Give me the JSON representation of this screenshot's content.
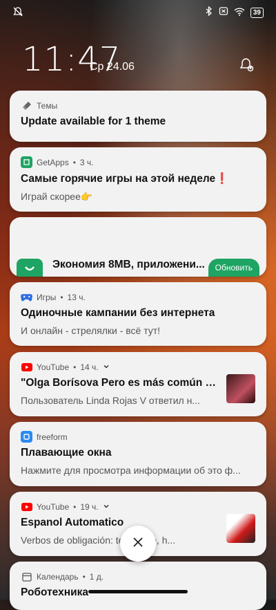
{
  "status_bar": {
    "battery": "39"
  },
  "lock": {
    "time": "11:47",
    "date": "Ср 24.06"
  },
  "notifications": [
    {
      "app": "Темы",
      "time": "",
      "title": "Update available for 1 theme",
      "body": ""
    },
    {
      "app": "GetApps",
      "time": "3 ч.",
      "title": "Самые горячие игры на этой неделе❗",
      "body": "Играй скорее👉"
    },
    {
      "app": "",
      "time": "",
      "title": "Экономия 8MB, приложени...",
      "body": "",
      "button": "Обновить"
    },
    {
      "app": "Игры",
      "time": "13 ч.",
      "title": "Одиночные кампании без интернета",
      "body": "И онлайн - стрелялки - всё тут!"
    },
    {
      "app": "YouTube",
      "time": "14 ч.",
      "title": "\"Olga Borísova Pero es más común esc...",
      "body": "Пользователь Linda Rojas V ответил н..."
    },
    {
      "app": "freeform",
      "time": "",
      "title": "Плавающие окна",
      "body": "Нажмите для просмотра информации об это ф..."
    },
    {
      "app": "YouTube",
      "time": "19 ч.",
      "title": "Espanol Automatico",
      "body": "Verbos de obligación: tener que, h..."
    },
    {
      "app": "Календарь",
      "time": "1 д.",
      "title": "Роботехника",
      "body": ""
    }
  ],
  "colors": {
    "youtube_red": "#ff0000",
    "getapps_green": "#1ea463",
    "games_blue": "#2f6de1",
    "freeform_blue": "#2a8cf0"
  }
}
